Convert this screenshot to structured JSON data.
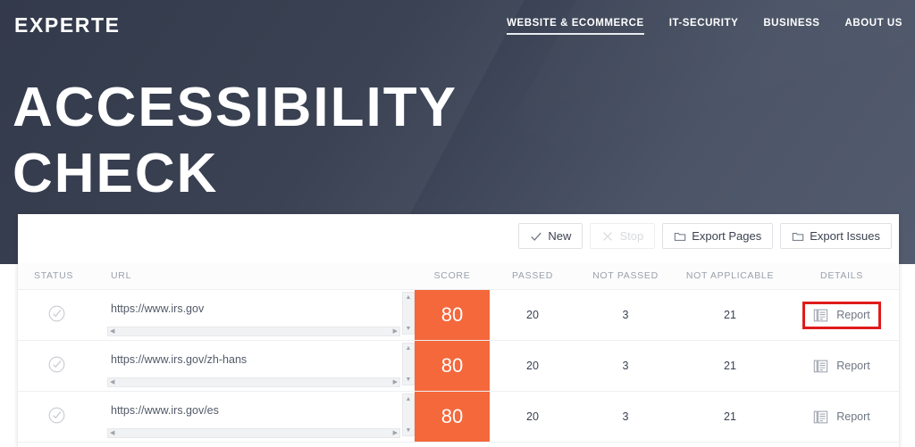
{
  "brand": {
    "logo": "EXPERTE"
  },
  "nav": {
    "items": [
      {
        "label": "WEBSITE & ECOMMERCE",
        "active": true
      },
      {
        "label": "IT-SECURITY",
        "active": false
      },
      {
        "label": "BUSINESS",
        "active": false
      },
      {
        "label": "ABOUT US",
        "active": false
      }
    ]
  },
  "hero": {
    "title": "ACCESSIBILITY CHECK"
  },
  "toolbar": {
    "new_label": "New",
    "stop_label": "Stop",
    "export_pages_label": "Export Pages",
    "export_issues_label": "Export Issues"
  },
  "table": {
    "columns": {
      "status": "STATUS",
      "url": "URL",
      "score": "SCORE",
      "passed": "PASSED",
      "not_passed": "NOT PASSED",
      "not_applicable": "NOT APPLICABLE",
      "details": "DETAILS"
    },
    "details_label": "Report",
    "rows": [
      {
        "status_icon": "check-circle-icon",
        "url": "https://www.irs.gov",
        "score": "80",
        "passed": "20",
        "not_passed": "3",
        "not_applicable": "21",
        "details": "Report",
        "flagged": true
      },
      {
        "status_icon": "check-circle-icon",
        "url": "https://www.irs.gov/zh-hans",
        "score": "80",
        "passed": "20",
        "not_passed": "3",
        "not_applicable": "21",
        "details": "Report",
        "flagged": false
      },
      {
        "status_icon": "check-circle-icon",
        "url": "https://www.irs.gov/es",
        "score": "80",
        "passed": "20",
        "not_passed": "3",
        "not_applicable": "21",
        "details": "Report",
        "flagged": false
      }
    ]
  },
  "colors": {
    "hero_dark": "#2c3345",
    "hero_light": "#535c6e",
    "score_orange": "#f4683c",
    "not_passed_red": "#e8607a",
    "highlight_red": "#e01b1b"
  }
}
